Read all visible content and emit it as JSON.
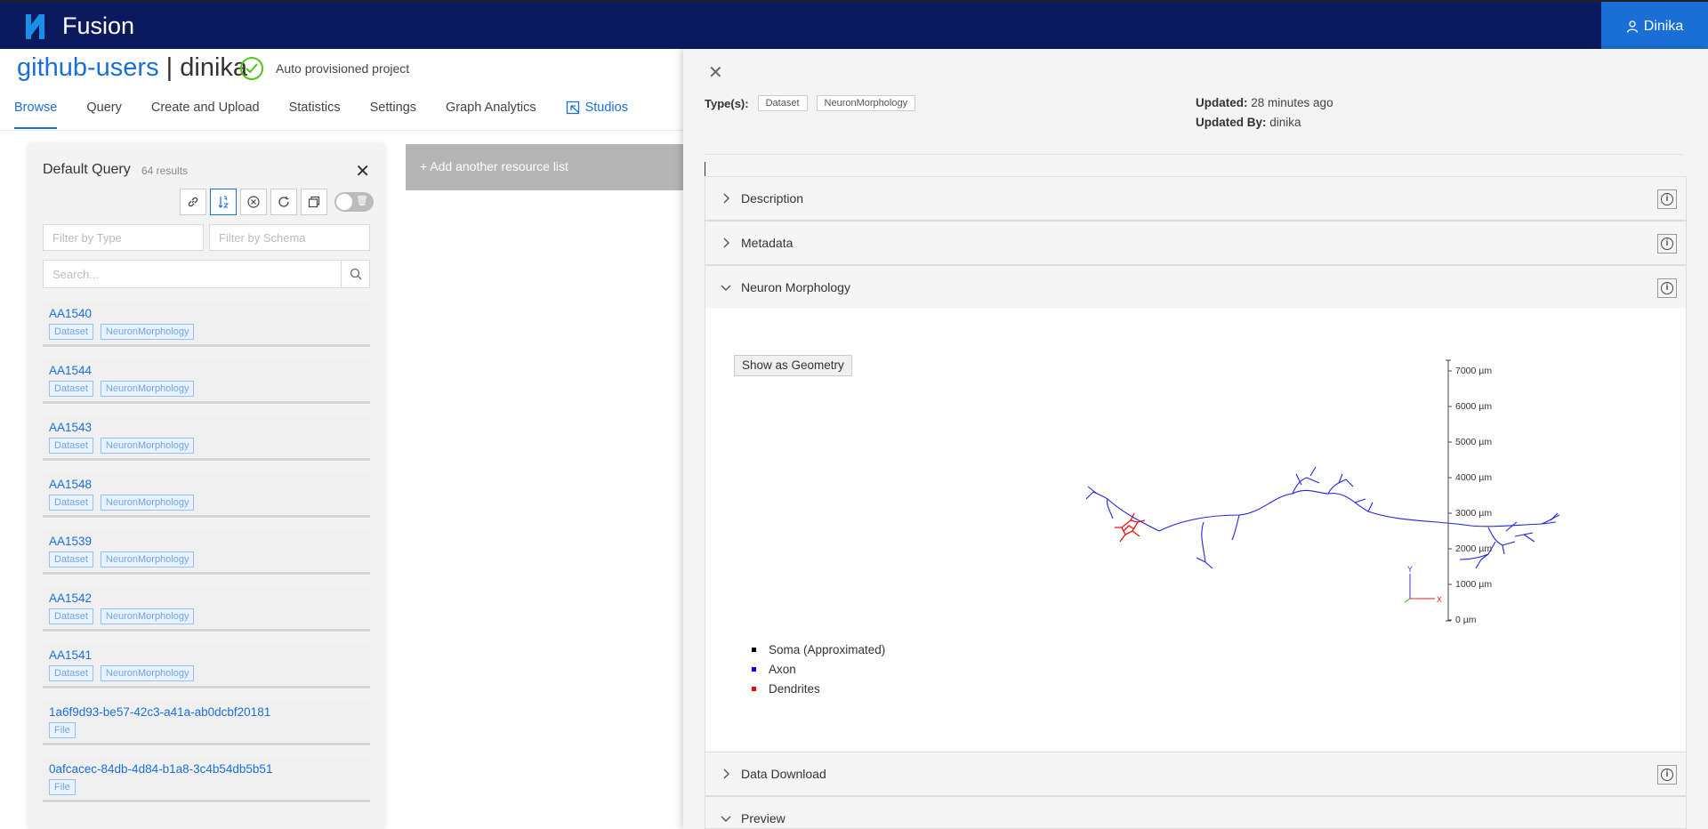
{
  "app": {
    "brand": "Fusion",
    "logo_letter": "N",
    "user": "Dinika"
  },
  "project": {
    "org": "github-users",
    "separator": "|",
    "name": "dinika",
    "description": "Auto provisioned project"
  },
  "tabs": [
    {
      "label": "Browse",
      "active": true
    },
    {
      "label": "Query"
    },
    {
      "label": "Create and Upload"
    },
    {
      "label": "Statistics"
    },
    {
      "label": "Settings"
    },
    {
      "label": "Graph Analytics"
    },
    {
      "label": "Studios"
    }
  ],
  "list": {
    "title": "Default Query",
    "count": "64 results",
    "filter_type_placeholder": "Filter by Type",
    "filter_schema_placeholder": "Filter by Schema",
    "search_placeholder": "Search...",
    "items": [
      {
        "name": "AA1540",
        "tags": [
          "Dataset",
          "NeuronMorphology"
        ]
      },
      {
        "name": "AA1544",
        "tags": [
          "Dataset",
          "NeuronMorphology"
        ]
      },
      {
        "name": "AA1543",
        "tags": [
          "Dataset",
          "NeuronMorphology"
        ]
      },
      {
        "name": "AA1548",
        "tags": [
          "Dataset",
          "NeuronMorphology"
        ]
      },
      {
        "name": "AA1539",
        "tags": [
          "Dataset",
          "NeuronMorphology"
        ]
      },
      {
        "name": "AA1542",
        "tags": [
          "Dataset",
          "NeuronMorphology"
        ]
      },
      {
        "name": "AA1541",
        "tags": [
          "Dataset",
          "NeuronMorphology"
        ]
      },
      {
        "name": "1a6f9d93-be57-42c3-a41a-ab0dcbf20181",
        "tags": [
          "File"
        ]
      },
      {
        "name": "0afcacec-84db-4d84-b1a8-3c4b54db5b51",
        "tags": [
          "File"
        ]
      }
    ]
  },
  "add_list_label": "+ Add another resource list",
  "resource": {
    "types_label": "Type(s):",
    "types": [
      "Dataset",
      "NeuronMorphology"
    ],
    "updated_label": "Updated:",
    "updated_value": "28 minutes ago",
    "updated_by_label": "Updated By:",
    "updated_by_value": "dinika"
  },
  "sections": {
    "description": "Description",
    "metadata": "Metadata",
    "morphology": "Neuron Morphology",
    "download": "Data Download",
    "preview": "Preview"
  },
  "morphology": {
    "show_geometry": "Show as Geometry",
    "scale_ticks": [
      "7000 µm",
      "6000 µm",
      "5000 µm",
      "4000 µm",
      "3000 µm",
      "2000 µm",
      "1000 µm",
      "0 µm"
    ],
    "legend": [
      {
        "label": "Soma (Approximated)",
        "color": "#000000"
      },
      {
        "label": "Axon",
        "color": "#0000ff"
      },
      {
        "label": "Dendrites",
        "color": "#ff0000"
      }
    ],
    "axis_x": "X",
    "axis_y": "Y"
  }
}
